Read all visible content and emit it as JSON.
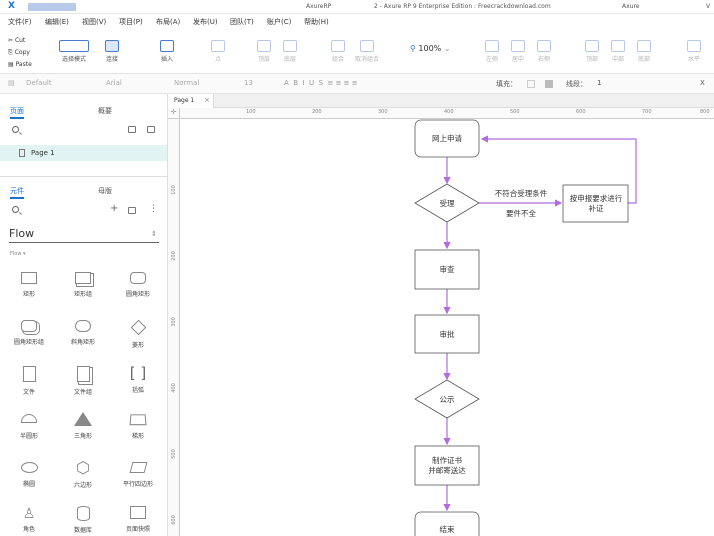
{
  "titlebar": {
    "app_name": "AxureRP",
    "window_title": "2 - Axure RP 9 Enterprise Edition : Freecrackdownload.com",
    "brand": "Axure",
    "version_letter": "V"
  },
  "menu": [
    "文件(F)",
    "编辑(E)",
    "视图(V)",
    "项目(P)",
    "布局(A)",
    "发布(U)",
    "团队(T)",
    "账户(C)",
    "帮助(H)"
  ],
  "clipboard": {
    "cut": "Cut",
    "copy": "Copy",
    "paste": "Paste"
  },
  "toolbar": {
    "select_mode": "选择模式",
    "connect": "连接",
    "insert": "插入",
    "point": "点",
    "top_layer": "顶层",
    "bottom_layer": "底层",
    "group": "组合",
    "ungroup": "取消组合",
    "zoom": "100%",
    "left": "左侧",
    "center": "居中",
    "right": "右侧",
    "top": "顶部",
    "middle": "中部",
    "bottom": "底部",
    "horizontal": "水平"
  },
  "format": {
    "style": "Default",
    "font": "Arial",
    "weight": "Normal",
    "size": "13",
    "fill_label": "填充：",
    "line_label": "线段：",
    "line_width": "1",
    "x_label": "X"
  },
  "pages_panel": {
    "tab_pages": "页面",
    "tab_outline": "概要",
    "page_name": "Page 1"
  },
  "library_panel": {
    "tab_libraries": "元件",
    "tab_masters": "母版",
    "library_name": "Flow",
    "sublabel": "Flow ▾",
    "items": [
      "矩形",
      "矩形组",
      "圆角矩形",
      "圆角矩形组",
      "斜角矩形",
      "菱形",
      "文件",
      "文件组",
      "括弧",
      "半圆形",
      "三角形",
      "梯形",
      "椭圆",
      "六边形",
      "平行四边形",
      "角色",
      "数据库",
      "页面快照"
    ]
  },
  "canvas": {
    "tab_label": "Page 1",
    "ruler_top": [
      "100",
      "200",
      "300",
      "400",
      "500",
      "600",
      "700",
      "800"
    ],
    "ruler_left": [
      "100",
      "200",
      "300",
      "400",
      "500",
      "600"
    ]
  },
  "flowchart": {
    "nodes": [
      "网上申请",
      "受理",
      "审查",
      "审批",
      "公示",
      "制作证书",
      "并邮寄送达",
      "结束",
      "按申报要求进行",
      "补证"
    ],
    "edge_label_1": "不符合受理条件",
    "edge_label_2": "要件不全"
  },
  "colors": {
    "accent": "#1a73c9",
    "connector": "#b56be0",
    "node_border": "#555555",
    "selected_row": "#e2f3f3"
  }
}
